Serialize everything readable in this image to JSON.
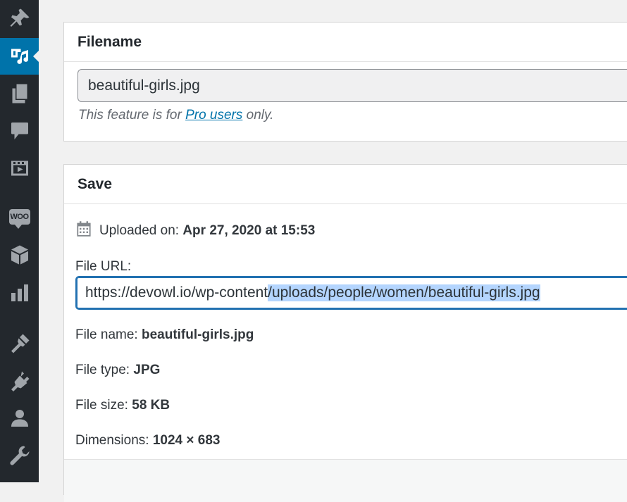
{
  "sidebar": {
    "items": [
      {
        "icon": "pin-icon"
      },
      {
        "icon": "media-icon",
        "active": true
      },
      {
        "icon": "pages-icon"
      },
      {
        "icon": "comments-icon"
      },
      {
        "icon": "video-icon"
      },
      {
        "icon": "woocommerce-icon",
        "badge_text": "WOO"
      },
      {
        "icon": "products-box-icon"
      },
      {
        "icon": "analytics-icon"
      },
      {
        "icon": "appearance-icon"
      },
      {
        "icon": "plugins-icon"
      },
      {
        "icon": "users-icon"
      },
      {
        "icon": "tools-icon"
      }
    ],
    "accent_color": "#0073aa",
    "background_color": "#23282d"
  },
  "filename_panel": {
    "title": "Filename",
    "value": "beautiful-girls.jpg",
    "note_prefix": "This feature is for ",
    "note_link": "Pro users",
    "note_suffix": " only."
  },
  "save_panel": {
    "title": "Save",
    "uploaded_label": "Uploaded on:",
    "uploaded_value": "Apr 27, 2020 at 15:53",
    "file_url_label": "File URL:",
    "file_url_plain": "https://devowl.io/wp-content",
    "file_url_selected": "/uploads/people/women/beautiful-girls.jpg",
    "file_name_label": "File name:",
    "file_name_value": "beautiful-girls.jpg",
    "file_type_label": "File type:",
    "file_type_value": "JPG",
    "file_size_label": "File size:",
    "file_size_value": "58 KB",
    "dimensions_label": "Dimensions:",
    "dimensions_value": "1024 × 683"
  }
}
